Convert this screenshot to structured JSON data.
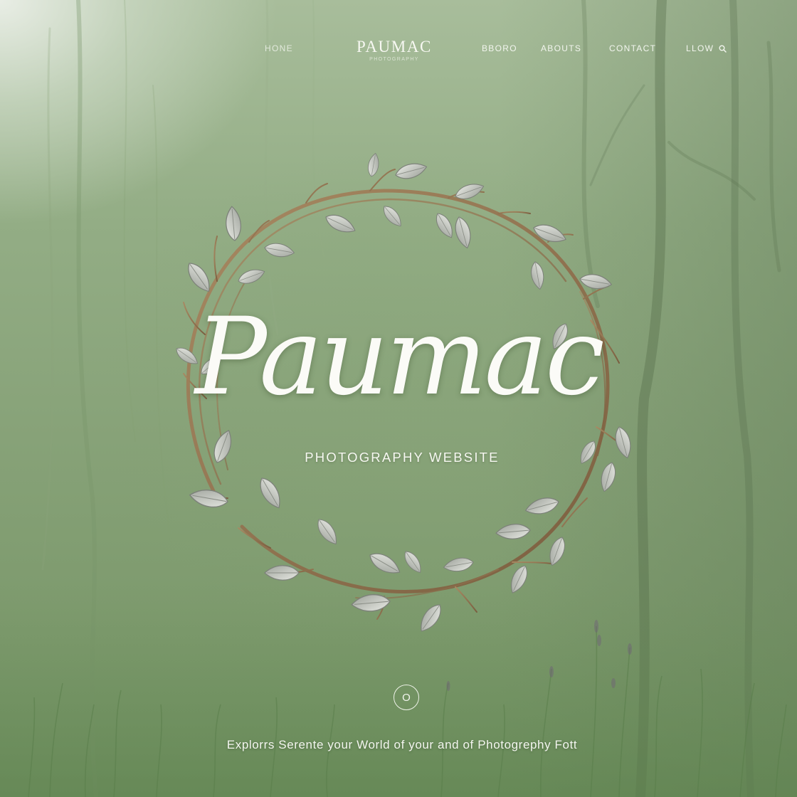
{
  "nav": {
    "home": "HONE",
    "brand": {
      "name": "PAUMAC",
      "tagline": "PHOTOGRAPHY"
    },
    "blog": "BBORO",
    "about": "ABOUTS",
    "contact": "CONTACT",
    "search_label": "LLOW",
    "search_icon": "search-icon"
  },
  "hero": {
    "title": "Paumac",
    "subtitle": "PHOTOGRAPHY WEBSITE",
    "scroll_button": "O",
    "caption": "Explorrs Serente your World of your and of Photogrephy Fott"
  },
  "colors": {
    "background_green": "#87a278",
    "text_white": "#f6f7f1",
    "wreath_branch": "#8a6e4c",
    "wreath_leaf": "#c9ccc6"
  }
}
